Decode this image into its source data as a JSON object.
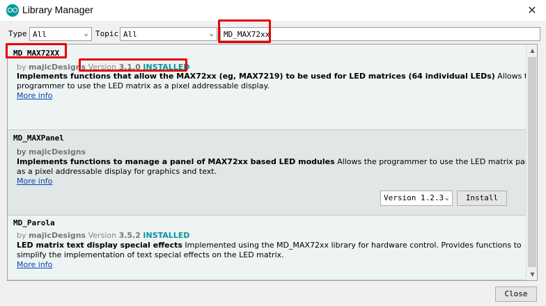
{
  "window": {
    "title": "Library Manager",
    "close_glyph": "✕"
  },
  "filters": {
    "type_label": "Type",
    "type_value": "All",
    "topic_label": "Topic",
    "topic_value": "All",
    "search_value": "MD_MAX72xx"
  },
  "libraries": [
    {
      "name": "MD_MAX72XX",
      "by": "by",
      "author": "majicDesigns",
      "version_label": "Version",
      "version": "3.1.0",
      "status": "INSTALLED",
      "desc_bold": "Implements functions that allow the MAX72xx (eg, MAX7219) to be used for LED matrices (64 individual LEDs)",
      "desc_rest": " Allows the",
      "desc_line2": "programmer to use the LED matrix as a pixel addressable display.",
      "more_info": "More info"
    },
    {
      "name": "MD_MAXPanel",
      "by": "by",
      "author": "majicDesigns",
      "desc_bold": "Implements functions to manage a panel of MAX72xx based LED modules",
      "desc_rest": " Allows the programmer to use the LED matrix panel",
      "desc_line2": "as a pixel addressable display for graphics and text.",
      "more_info": "More info",
      "version_select": "Version 1.2.3",
      "install_label": "Install"
    },
    {
      "name": "MD_Parola",
      "by": "by",
      "author": "majicDesigns",
      "version_label": "Version",
      "version": "3.5.2",
      "status": "INSTALLED",
      "desc_bold": "LED matrix text display special effects",
      "desc_rest": " Implemented using the MD_MAX72xx library for hardware control. Provides functions to",
      "desc_line2": "simplify the implementation of text special effects on the LED matrix.",
      "more_info": "More info"
    }
  ],
  "footer": {
    "close_label": "Close"
  },
  "colors": {
    "installed": "#00979c",
    "link": "#0645ad",
    "highlight": "#e60000"
  }
}
